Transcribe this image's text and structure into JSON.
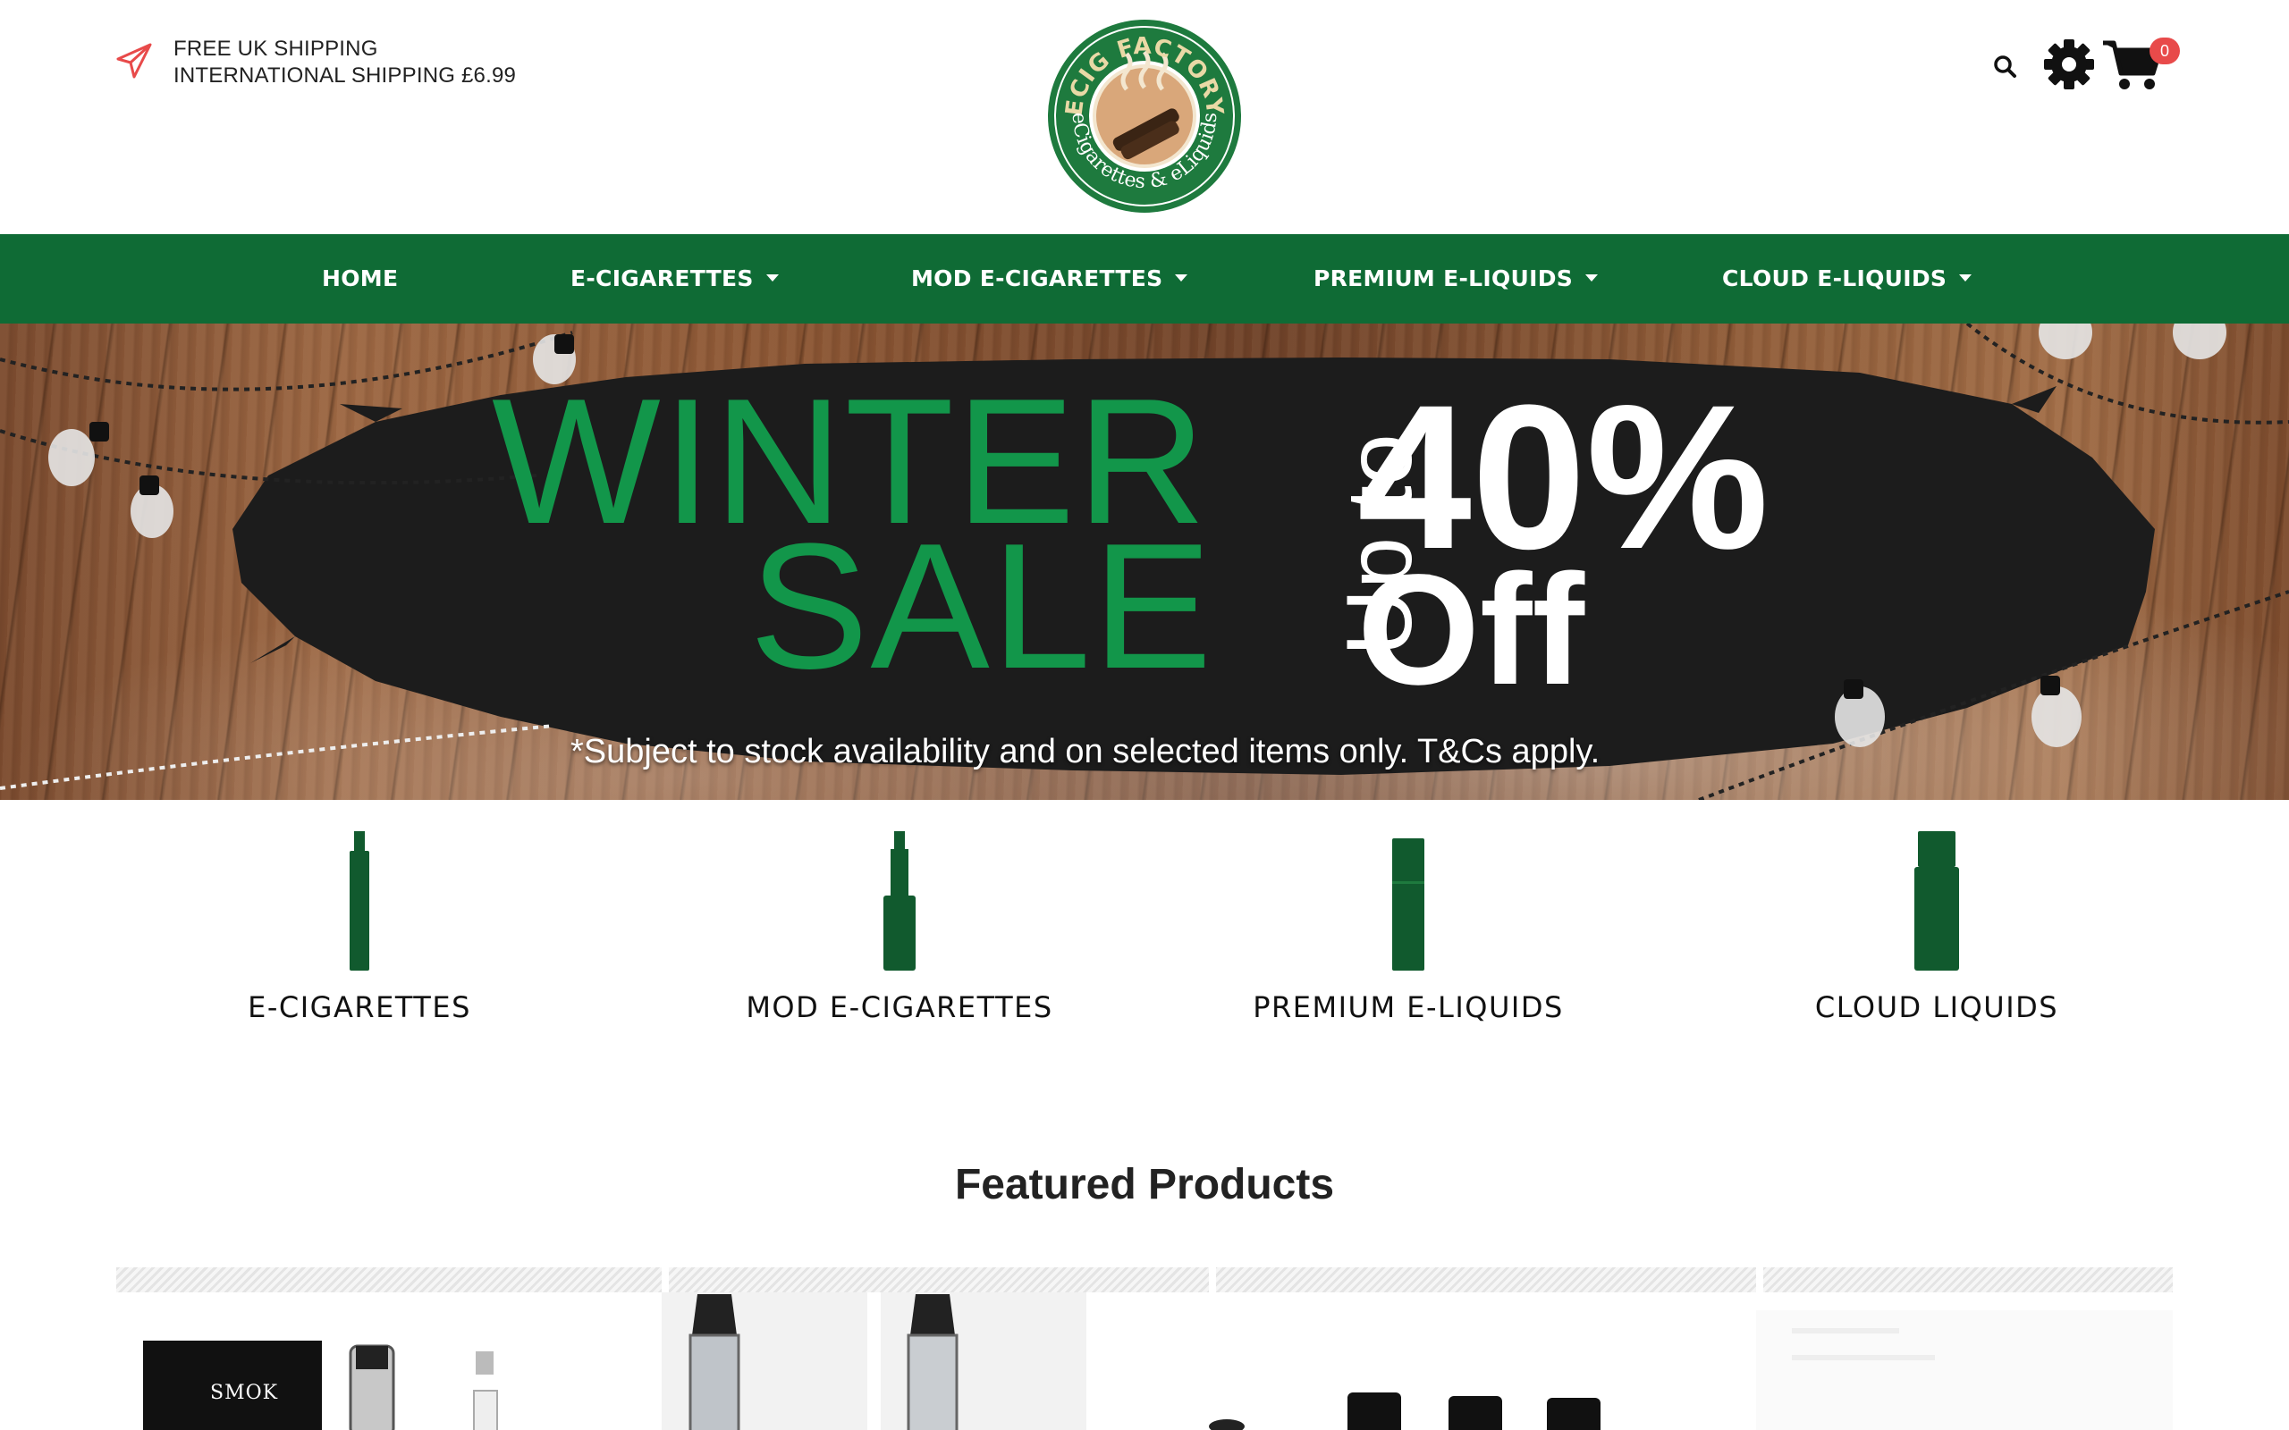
{
  "header": {
    "shipping_line1": "FREE UK SHIPPING",
    "shipping_line2": "INTERNATIONAL SHIPPING £6.99",
    "logo_text_top": "ECIG FACTORY",
    "logo_text_bottom": "eCigarettes & eLiquids",
    "cart_count": "0",
    "icons": [
      "paper-plane-icon",
      "search-icon",
      "gear-icon",
      "cart-icon"
    ]
  },
  "nav": {
    "items": [
      {
        "label": "HOME",
        "dropdown": false
      },
      {
        "label": "E-CIGARETTES",
        "dropdown": true
      },
      {
        "label": "MOD E-CIGARETTES",
        "dropdown": true
      },
      {
        "label": "PREMIUM E-LIQUIDS",
        "dropdown": true
      },
      {
        "label": "CLOUD E-LIQUIDS",
        "dropdown": true
      }
    ]
  },
  "banner": {
    "line1": "WINTER",
    "line2": "SALE",
    "upto": "Up to",
    "percent": "40%",
    "off": "Off",
    "disclaimer": "*Subject to stock availability and on selected items only. T&Cs apply."
  },
  "categories": [
    {
      "label": "E-CIGARETTES",
      "icon": "ecig-icon"
    },
    {
      "label": "MOD E-CIGARETTES",
      "icon": "mod-ecig-icon"
    },
    {
      "label": "PREMIUM E-LIQUIDS",
      "icon": "premium-liquid-icon"
    },
    {
      "label": "CLOUD LIQUIDS",
      "icon": "cloud-liquid-icon"
    }
  ],
  "featured": {
    "title": "Featured Products",
    "product1_brand": "SMOK"
  },
  "colors": {
    "brand_green": "#0f6b35",
    "sale_green": "#12964a",
    "badge_red": "#e84a4a",
    "plane_red": "#e84a4a"
  }
}
